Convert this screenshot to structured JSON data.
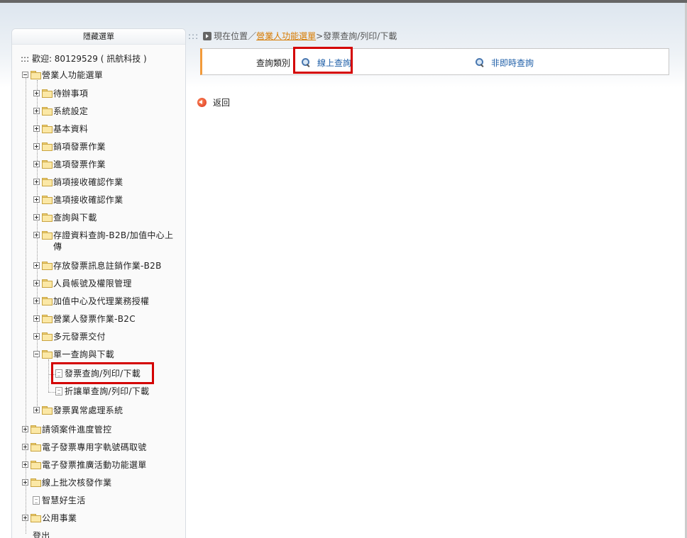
{
  "sidebar": {
    "toggle_label": "隱藏選單",
    "welcome": "::: 歡迎: 80129529 ( 訊航科技 )",
    "root": "營業人功能選單",
    "items": [
      "待辦事項",
      "系統設定",
      "基本資料",
      "銷項發票作業",
      "進項發票作業",
      "銷項接收確認作業",
      "進項接收確認作業",
      "查詢與下載",
      "存證資料查詢-B2B/加值中心上傳",
      "存放發票訊息註銷作業-B2B",
      "人員帳號及權限管理",
      "加值中心及代理業務授權",
      "營業人發票作業-B2C",
      "多元發票交付",
      "單一查詢與下載"
    ],
    "subitems": [
      "發票查詢/列印/下載",
      "折讓單查詢/列印/下載"
    ],
    "item_after": "發票異常處理系統",
    "top_level": [
      "請領案件進度管控",
      "電子發票專用字軌號碼取號",
      "電子發票推廣活動功能選單",
      "線上批次核發作業",
      "智慧好生活",
      "公用事業",
      "登出"
    ]
  },
  "breadcrumb": {
    "dots": ":::",
    "prefix": "現在位置／",
    "link": "營業人功能選單",
    "sep": " >",
    "current": "發票查詢/列印/下載"
  },
  "query": {
    "label": "查詢類別",
    "option_online": "線上查詢",
    "option_offline": "非即時查詢"
  },
  "back_label": "返回",
  "colors": {
    "accent_orange": "#f29a3a",
    "link_blue": "#1f5fa8",
    "highlight_red": "#d40000"
  }
}
